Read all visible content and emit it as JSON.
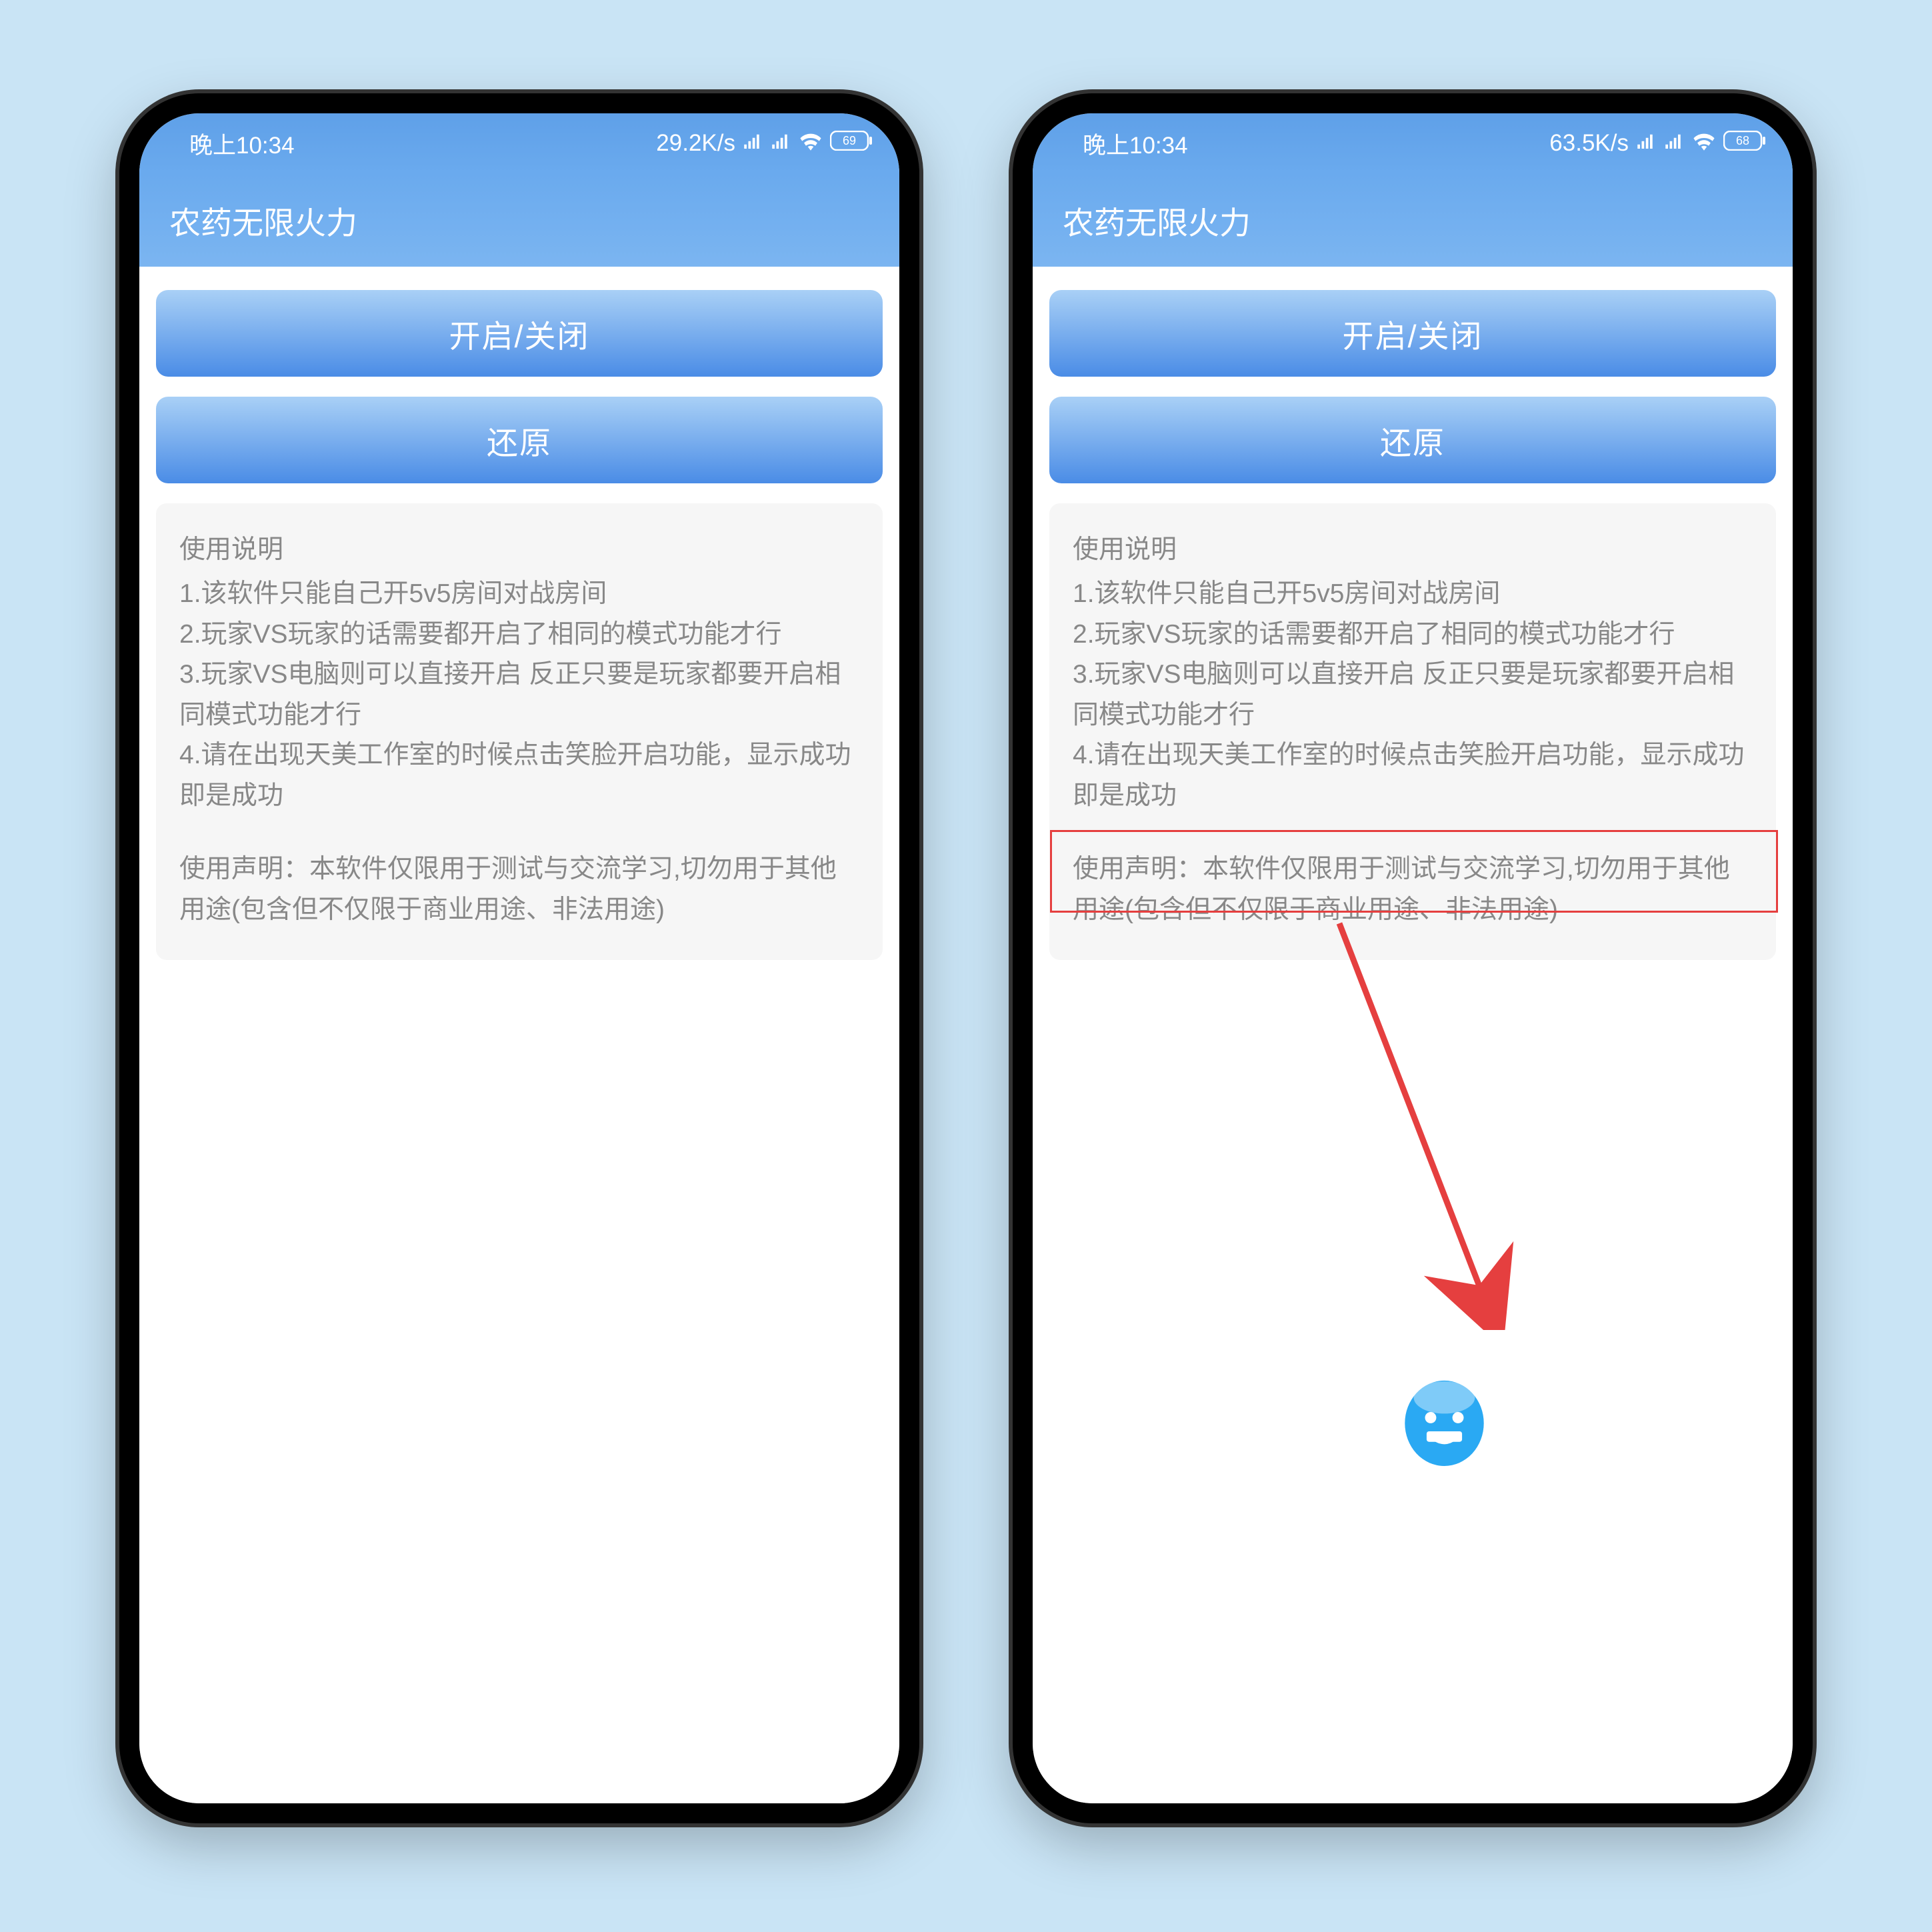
{
  "phones": [
    {
      "status": {
        "time": "晚上10:34",
        "netspeed": "29.2K/s",
        "battery": "69"
      },
      "title": "农药无限火力",
      "btn_toggle": "开启/关闭",
      "btn_restore": "还原",
      "card": {
        "heading": "使用说明",
        "l1": "1.该软件只能自己开5v5房间对战房间",
        "l2": "2.玩家VS玩家的话需要都开启了相同的模式功能才行",
        "l3": "3.玩家VS电脑则可以直接开启 反正只要是玩家都要开启相同模式功能才行",
        "l4": "4.请在出现天美工作室的时候点击笑脸开启功能，显示成功即是成功",
        "disclaimer": "使用声明：本软件仅限用于测试与交流学习,切勿用于其他用途(包含但不仅限于商业用途、非法用途)"
      }
    },
    {
      "status": {
        "time": "晚上10:34",
        "netspeed": "63.5K/s",
        "battery": "68"
      },
      "title": "农药无限火力",
      "btn_toggle": "开启/关闭",
      "btn_restore": "还原",
      "card": {
        "heading": "使用说明",
        "l1": "1.该软件只能自己开5v5房间对战房间",
        "l2": "2.玩家VS玩家的话需要都开启了相同的模式功能才行",
        "l3": "3.玩家VS电脑则可以直接开启 反正只要是玩家都要开启相同模式功能才行",
        "l4": "4.请在出现天美工作室的时候点击笑脸开启功能，显示成功即是成功",
        "disclaimer": "使用声明：本软件仅限用于测试与交流学习,切勿用于其他用途(包含但不仅限于商业用途、非法用途)"
      }
    }
  ]
}
